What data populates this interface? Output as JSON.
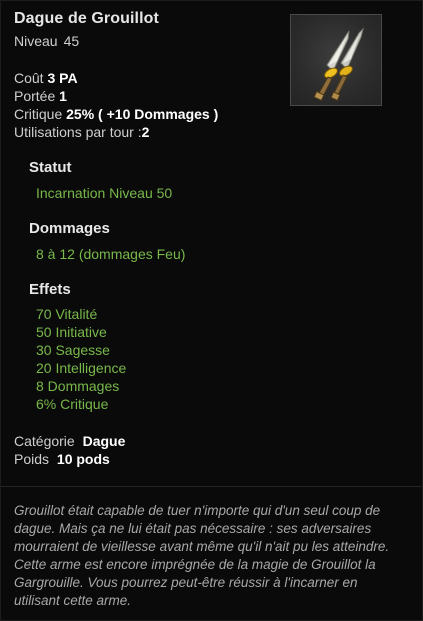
{
  "item": {
    "name": "Dague de Grouillot",
    "level_label": "Niveau",
    "level_value": "45",
    "icon": "dagger-pair-icon"
  },
  "stats": [
    {
      "label": "Coût",
      "value": "3 PA"
    },
    {
      "label": "Portée",
      "value": "1"
    },
    {
      "label": "Critique",
      "value": "25% ( +10 Dommages )"
    },
    {
      "label": "Utilisations par tour :",
      "value": "2"
    }
  ],
  "statut": {
    "heading": "Statut",
    "text": "Incarnation Niveau 50"
  },
  "dommages": {
    "heading": "Dommages",
    "text": "8 à 12 (dommages Feu)"
  },
  "effets": {
    "heading": "Effets",
    "items": [
      "70 Vitalité",
      "50 Initiative",
      "30 Sagesse",
      "20 Intelligence",
      "8 Dommages",
      "6% Critique"
    ]
  },
  "details": {
    "category_label": "Catégorie",
    "category_value": "Dague",
    "weight_label": "Poids",
    "weight_value": "10 pods"
  },
  "description": "Grouillot était capable de tuer n'importe qui d'un seul coup de dague. Mais ça ne lui était pas nécessaire : ses adversaires mourraient de vieillesse avant même qu'il n'ait pu les atteindre. Cette arme est encore imprégnée de la magie de Grouillot la Gargrouille. Vous pourrez peut-être réussir à l'incarner en utilisant cette arme.",
  "colors": {
    "background": "#0a0a0a",
    "effect_green": "#78b84a",
    "heading": "#e8e8e8",
    "description": "#a8a8a8"
  }
}
